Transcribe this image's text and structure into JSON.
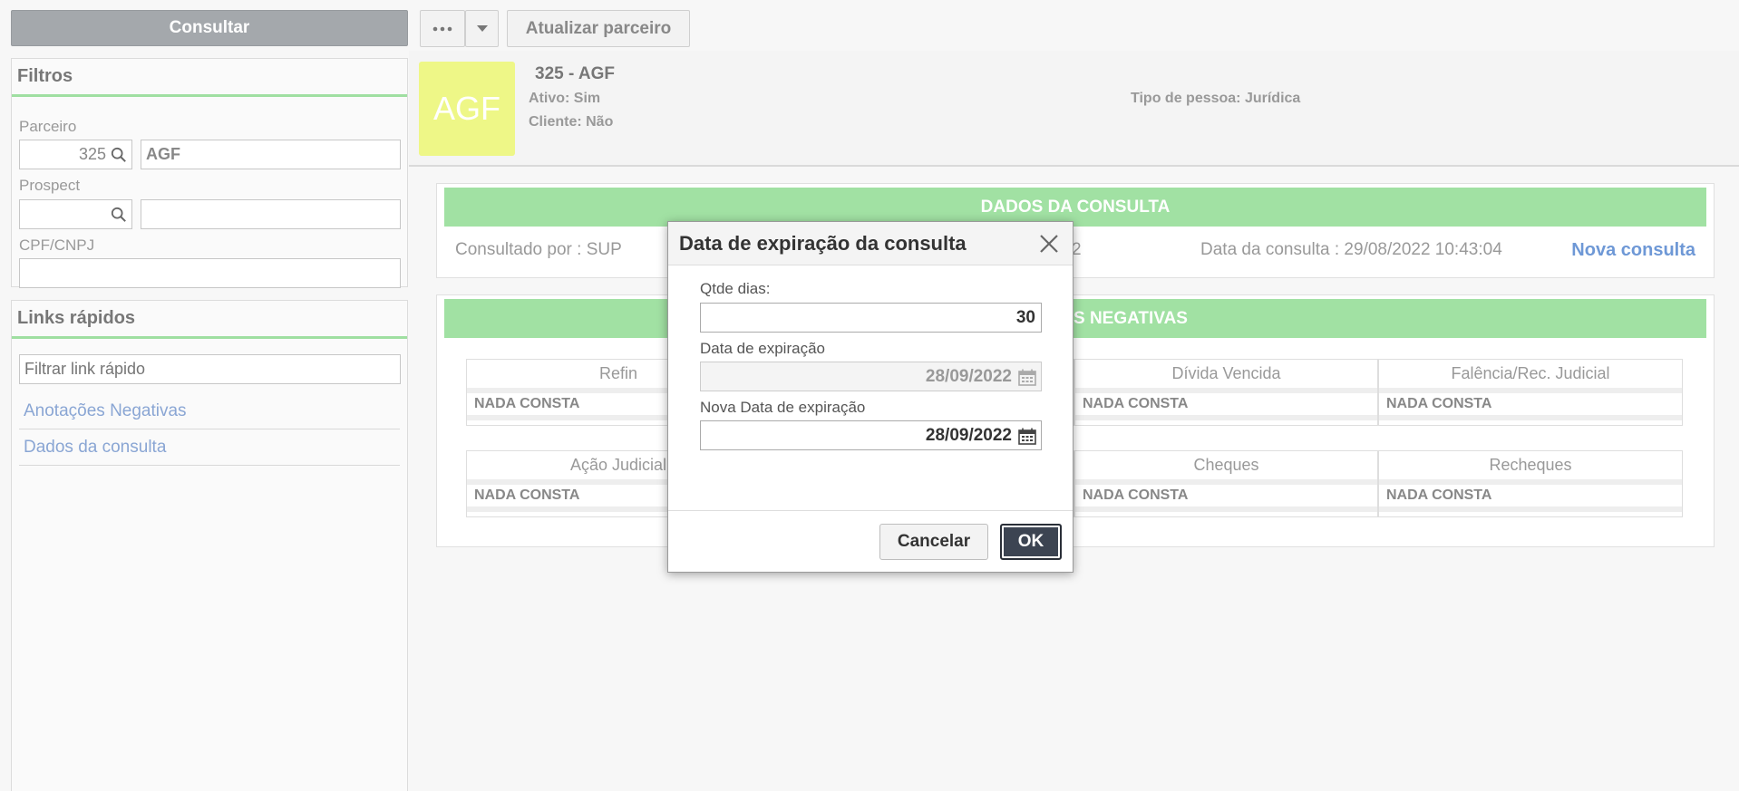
{
  "left": {
    "consultar_label": "Consultar",
    "filters": {
      "title": "Filtros",
      "parceiro_label": "Parceiro",
      "parceiro_code": "325",
      "parceiro_name": "AGF",
      "prospect_label": "Prospect",
      "prospect_code": "",
      "prospect_name": "",
      "cpf_label": "CPF/CNPJ",
      "cpf_value": ""
    },
    "links": {
      "title": "Links rápidos",
      "filter_placeholder": "Filtrar link rápido",
      "items": [
        "Anotações Negativas",
        "Dados da consulta"
      ]
    }
  },
  "toolbar": {
    "more_icon": "ellipsis-icon",
    "dropdown_icon": "caret-down-icon",
    "update_label": "Atualizar parceiro"
  },
  "header": {
    "avatar_text": "AGF",
    "title": "325 - AGF",
    "ativo": "Ativo: Sim",
    "cliente": "Cliente: Não",
    "tipo_pessoa": "Tipo de pessoa: Jurídica"
  },
  "dados": {
    "title": "DADOS DA CONSULTA",
    "consultado_por": "Consultado por : SUP",
    "partial": "2",
    "data_consulta": "Data da consulta : 29/08/2022 10:43:04",
    "nova_consulta": "Nova consulta"
  },
  "anotacoes": {
    "title_visible": "S NEGATIVAS",
    "row1": [
      {
        "header": "Refin",
        "value": "NADA CONSTA"
      },
      {
        "header": "Dívida Vencida",
        "value": "NADA CONSTA"
      },
      {
        "header": "Falência/Rec. Judicial",
        "value": "NADA CONSTA"
      }
    ],
    "row2": [
      {
        "header": "Ação Judicial",
        "value": "NADA CONSTA"
      },
      {
        "header": "Cheques",
        "value": "NADA CONSTA"
      },
      {
        "header": "Recheques",
        "value": "NADA CONSTA"
      }
    ]
  },
  "modal": {
    "title": "Data de expiração da consulta",
    "qtde_label": "Qtde dias:",
    "qtde_value": "30",
    "expiracao_label": "Data de expiração",
    "expiracao_value": "28/09/2022",
    "nova_label": "Nova Data de expiração",
    "nova_value": "28/09/2022",
    "cancel_label": "Cancelar",
    "ok_label": "OK"
  },
  "colors": {
    "accent_green": "#a1e1a3",
    "avatar_yellow": "#eef787",
    "link_blue": "#8aa6d4",
    "ok_dark": "#3c4452"
  }
}
